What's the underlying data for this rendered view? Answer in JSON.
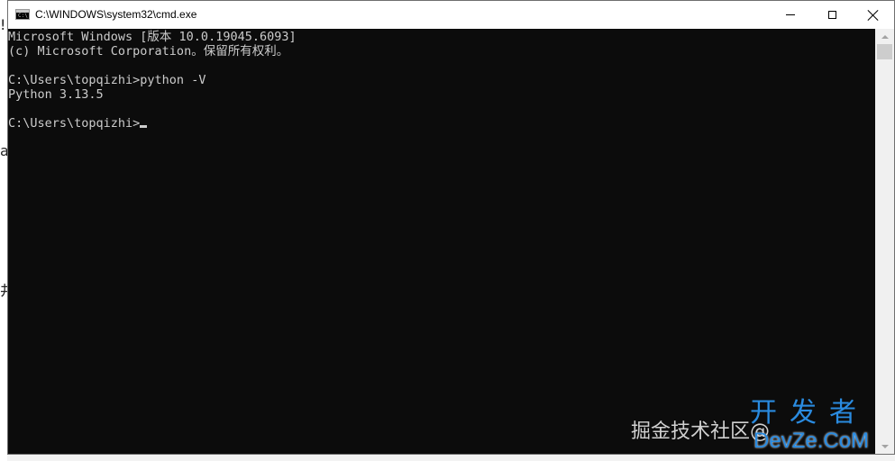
{
  "window": {
    "title": "C:\\WINDOWS\\system32\\cmd.exe",
    "icon": "cmd-icon"
  },
  "console": {
    "lines": [
      "Microsoft Windows [版本 10.0.19045.6093]",
      "(c) Microsoft Corporation。保留所有权利。",
      "C:\\Users\\topqizhi>python -V",
      "Python 3.13.5",
      "C:\\Users\\topqizhi>"
    ],
    "colors": {
      "background": "#0c0c0c",
      "foreground": "#cccccc"
    }
  },
  "watermark": {
    "text": "掘金技术社区@",
    "logo_top": "开发者",
    "logo_bottom": "DevZe.CoM",
    "color": "#2a8be0"
  }
}
